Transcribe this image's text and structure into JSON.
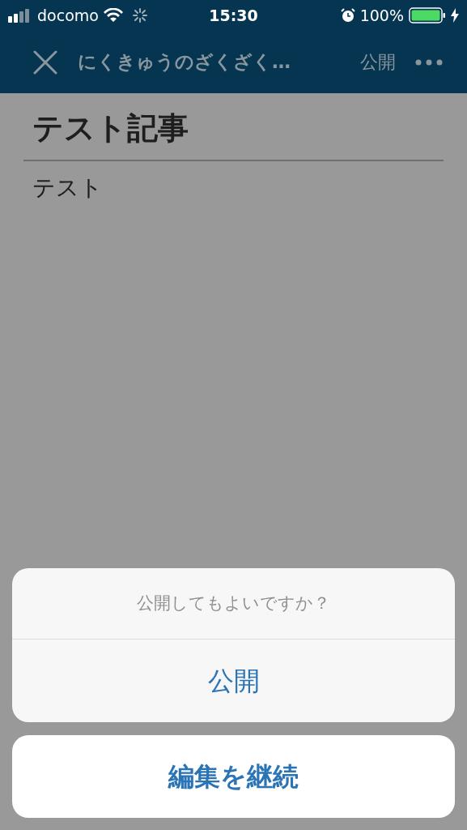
{
  "status_bar": {
    "carrier": "docomo",
    "time": "15:30",
    "battery": "100%"
  },
  "nav_bar": {
    "title": "にくきゅうのざくざく…",
    "publish": "公開"
  },
  "article": {
    "title": "テスト記事",
    "body": "テスト"
  },
  "action_sheet": {
    "message": "公開してもよいですか？",
    "actions": [
      {
        "label": "公開",
        "kind": "default"
      },
      {
        "label": "編集を継続",
        "kind": "cancel"
      }
    ]
  }
}
